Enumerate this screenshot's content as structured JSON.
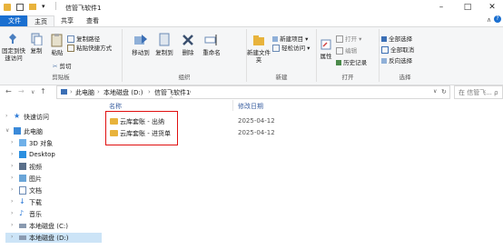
{
  "window": {
    "title": "信管飞软件1",
    "minimize": "–",
    "maximize": "□",
    "close": "✕"
  },
  "tabs": [
    {
      "label": "文件"
    },
    {
      "label": "主页"
    },
    {
      "label": "共享"
    },
    {
      "label": "查看"
    }
  ],
  "ribbon": {
    "clipboard": {
      "label": "剪贴板",
      "pin": "固定到快速访问",
      "copy": "复制",
      "paste": "粘贴",
      "copy_path": "复制路径",
      "paste_shortcut": "粘贴快捷方式",
      "cut": "剪切"
    },
    "organize": {
      "label": "组织",
      "move_to": "移动到",
      "copy_to": "复制到",
      "delete": "删除",
      "rename": "重命名"
    },
    "new": {
      "label": "新建",
      "new_folder": "新建文件夹",
      "new_item": "新建项目",
      "easy_access": "轻松访问"
    },
    "open": {
      "label": "打开",
      "properties": "属性",
      "open": "打开",
      "edit": "编辑",
      "history": "历史记录"
    },
    "select": {
      "label": "选择",
      "select_all": "全部选择",
      "select_none": "全部取消",
      "invert": "反向选择"
    }
  },
  "address": {
    "crumbs": [
      "此电脑",
      "本地磁盘 (D:)",
      "信管飞软件1"
    ],
    "search_placeholder": "在 信管飞... ρ"
  },
  "nav": [
    {
      "label": "快速访问"
    },
    {
      "label": "此电脑"
    },
    {
      "label": "3D 对象"
    },
    {
      "label": "Desktop"
    },
    {
      "label": "视频"
    },
    {
      "label": "图片"
    },
    {
      "label": "文档"
    },
    {
      "label": "下载"
    },
    {
      "label": "音乐"
    },
    {
      "label": "本地磁盘 (C:)"
    },
    {
      "label": "本地磁盘 (D:)"
    }
  ],
  "columns": {
    "name": "名称",
    "date": "修改日期"
  },
  "files": [
    {
      "name": "云库套账 - 出纳",
      "date": "2025-04-12"
    },
    {
      "name": "云库套账 - 进货单",
      "date": "2025-04-12"
    }
  ]
}
